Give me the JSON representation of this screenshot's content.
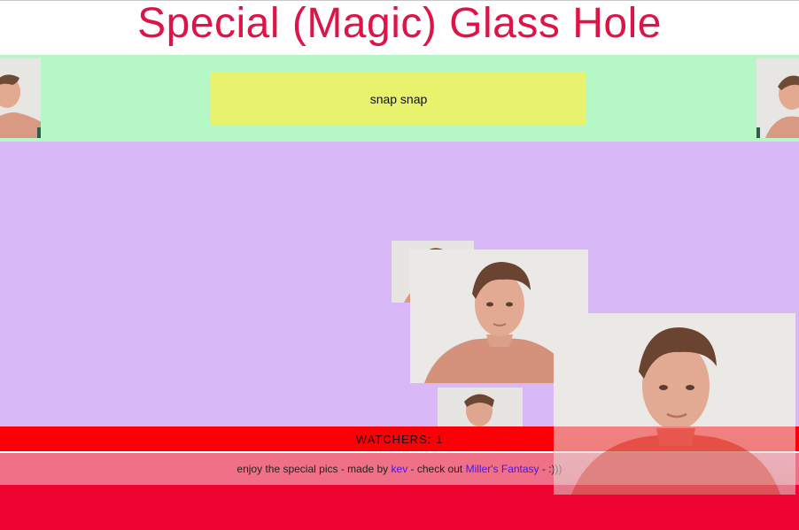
{
  "page": {
    "title": "Special (Magic) Glass Hole"
  },
  "controls": {
    "snap_label": "snap snap"
  },
  "status": {
    "watchers_label": "WATCHERS: 1"
  },
  "footer": {
    "text_before": "enjoy the special pics - made by ",
    "author_link": "kev",
    "text_middle": " - check out ",
    "promo_link": "Miller's Fantasy",
    "text_after": " - :)))"
  },
  "colors": {
    "title": "#dd1447",
    "green_bar": "#b6f8c5",
    "snap_button": "#e9f26d",
    "canvas": "#d8b8f6",
    "watchers_bar": "#fb0006",
    "footer": "#f07088",
    "bottom": "#ee0331",
    "link": "#4b16e6"
  }
}
